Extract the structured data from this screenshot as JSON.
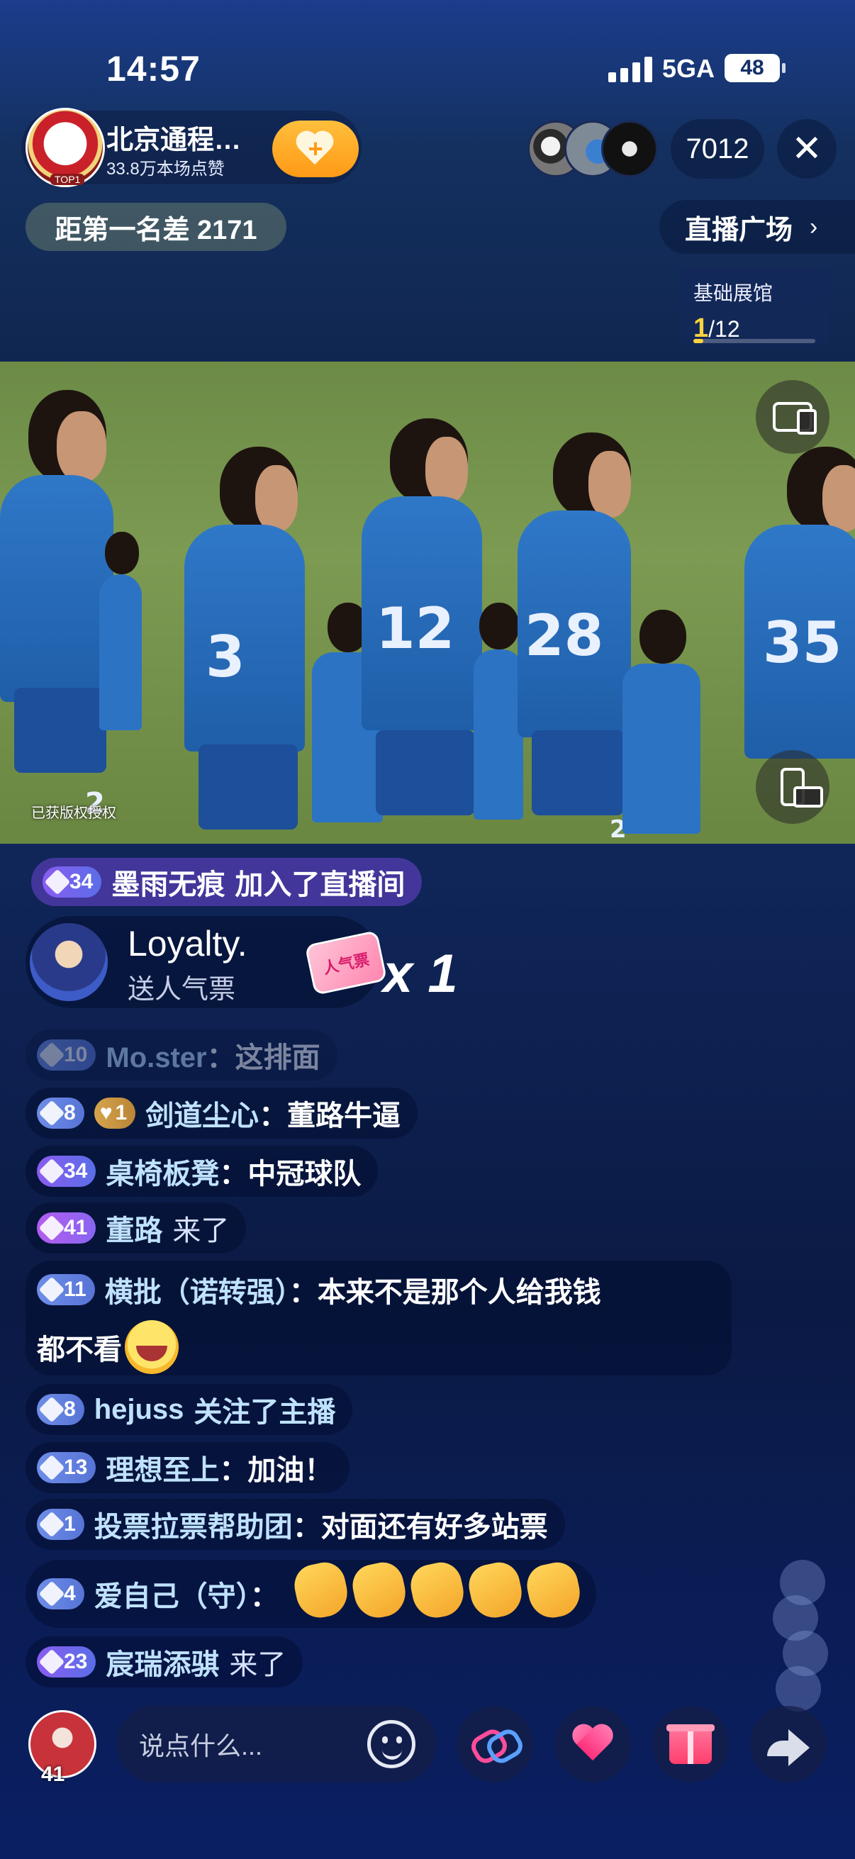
{
  "status_bar": {
    "time": "14:57",
    "network": "5GA",
    "battery": "48"
  },
  "header": {
    "host_name": "北京通程…",
    "host_likes": "33.8万本场点赞",
    "host_badge": "TOP1",
    "viewer_count": "7012",
    "rank_text": "距第一名差 2171",
    "plaza_label": "直播广场",
    "exhibit": {
      "title": "基础展馆",
      "current": "1",
      "total": "/12",
      "progress": 0.083
    }
  },
  "video": {
    "watermark": "已获版权授权",
    "jersey_numbers": [
      "3",
      "12",
      "28",
      "35",
      "2"
    ]
  },
  "join_event": {
    "level": "34",
    "user": "墨雨无痕",
    "action": "加入了直播间"
  },
  "gift": {
    "user": "Loyalty.",
    "action": "送人气票",
    "gift_label": "人气票",
    "multiplier": "x 1"
  },
  "chat": [
    {
      "level": "10",
      "user": "Mo.ster",
      "text": "：这排面",
      "faded": true,
      "chip": "blue"
    },
    {
      "level": "8",
      "fan_level": "1",
      "user": "剑道尘心",
      "text": "：董路牛逼",
      "chip": "blue"
    },
    {
      "level": "34",
      "user": "桌椅板凳",
      "text": "：中冠球队",
      "chip": "purple"
    },
    {
      "level": "41",
      "user": "董路",
      "text": "来了",
      "system": true,
      "chip": "pink"
    },
    {
      "level": "11",
      "user": "横批（诺转强）",
      "text": "：本来不是那个人给我钱",
      "text2": "都不看",
      "chip": "blue"
    },
    {
      "level": "8",
      "user": "hejuss",
      "text": "关注了主播",
      "system": true,
      "chip": "blue"
    },
    {
      "level": "13",
      "user": "理想至上",
      "text": "：加油！",
      "chip": "blue"
    },
    {
      "level": "1",
      "user": "投票拉票帮助团",
      "text": "：对面还有好多站票",
      "chip": "blue"
    },
    {
      "level": "4",
      "user": "爱自己（守）",
      "text": "：",
      "claps": 5,
      "chip": "blue"
    },
    {
      "level": "23",
      "user": "宸瑞添骐",
      "text": "来了",
      "system": true,
      "chip": "purple"
    }
  ],
  "bottom_bar": {
    "my_level": "41",
    "comment_placeholder": "说点什么..."
  },
  "colors": {
    "accent_gold": "#ffd23f",
    "follow_orange": "#ff9a17",
    "name_blue": "#bfe2ff"
  }
}
